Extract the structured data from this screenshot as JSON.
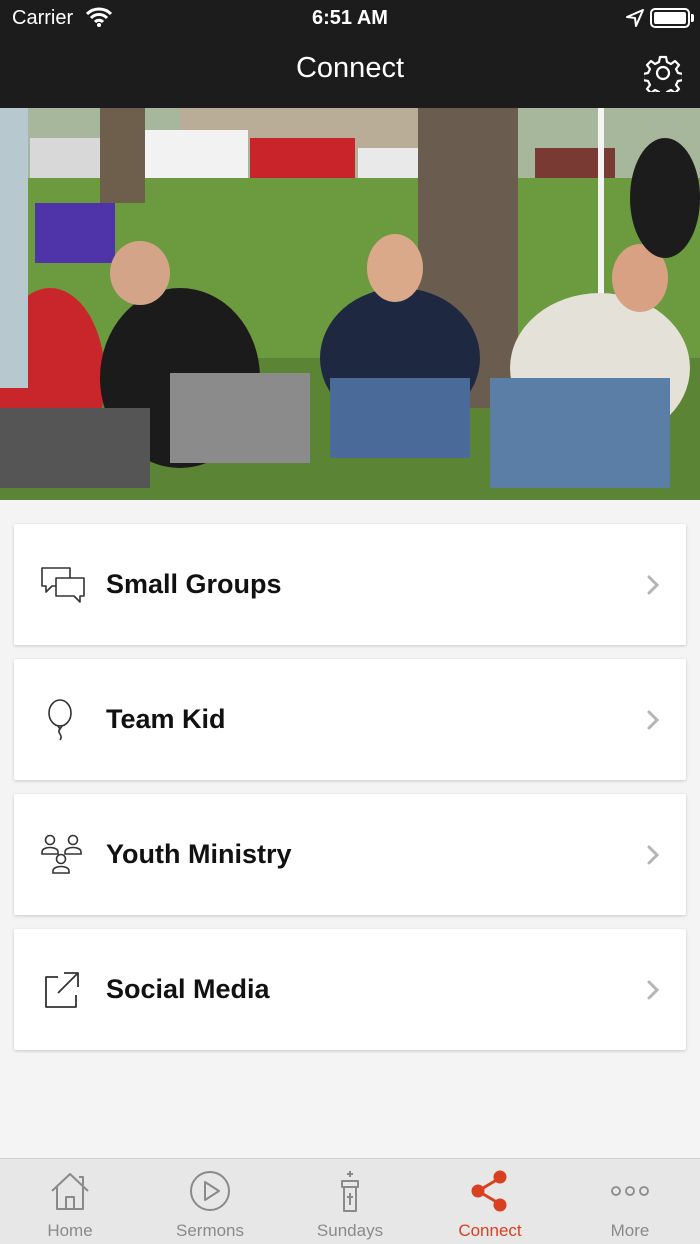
{
  "status_bar": {
    "carrier": "Carrier",
    "time": "6:51 AM"
  },
  "header": {
    "title": "Connect",
    "settings_icon": "gear-icon"
  },
  "hero": {
    "description_icon": "photo"
  },
  "menu": [
    {
      "label": "Small Groups",
      "icon": "chat-bubbles-icon"
    },
    {
      "label": "Team Kid",
      "icon": "balloon-icon"
    },
    {
      "label": "Youth Ministry",
      "icon": "people-group-icon"
    },
    {
      "label": "Social Media",
      "icon": "external-link-icon"
    }
  ],
  "tabbar": {
    "tabs": [
      {
        "label": "Home",
        "icon": "home-icon",
        "active": false
      },
      {
        "label": "Sermons",
        "icon": "play-circle-icon",
        "active": false
      },
      {
        "label": "Sundays",
        "icon": "church-icon",
        "active": false
      },
      {
        "label": "Connect",
        "icon": "share-icon",
        "active": true
      },
      {
        "label": "More",
        "icon": "more-dots-icon",
        "active": false
      }
    ]
  },
  "colors": {
    "header_bg": "#1c1c1c",
    "accent": "#d9401f",
    "tab_inactive": "#8a8a8a"
  }
}
